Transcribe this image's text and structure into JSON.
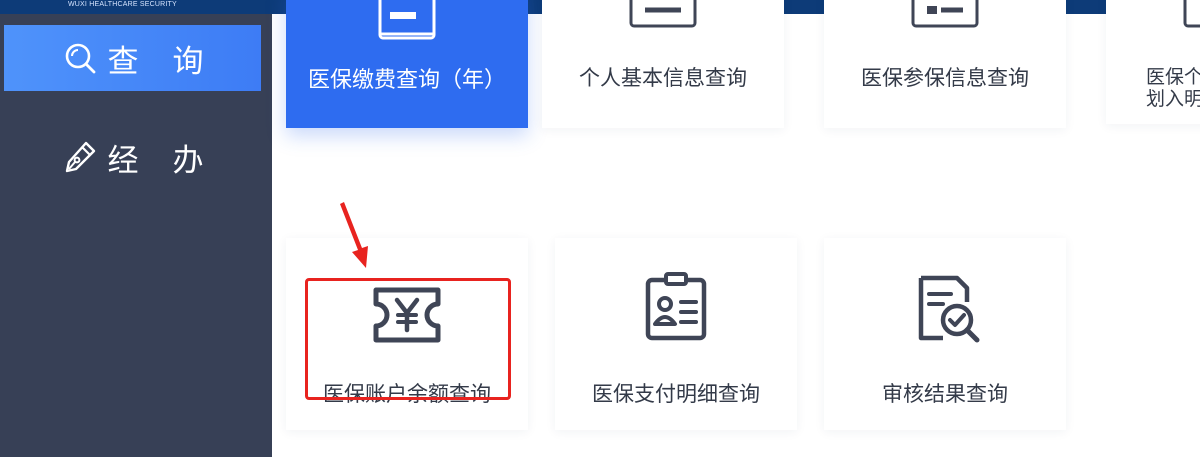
{
  "header": {
    "brand_subtitle": "WUXI HEALTHCARE SECURITY"
  },
  "sidebar": {
    "items": [
      {
        "label": "查询",
        "icon": "search-icon",
        "active": true
      },
      {
        "label": "经办",
        "icon": "pen-icon",
        "active": false
      }
    ]
  },
  "cards_top": [
    {
      "label": "医保缴费查询（年）",
      "selected": true,
      "icon": "document-card-icon"
    },
    {
      "label": "个人基本信息查询",
      "selected": false,
      "icon": "document-card-icon"
    },
    {
      "label": "医保参保信息查询",
      "selected": false,
      "icon": "document-card-icon"
    },
    {
      "label_line1": "医保个",
      "label_line2": "划入明",
      "selected": false,
      "icon": "document-card-icon"
    }
  ],
  "cards_bottom": [
    {
      "label": "医保账户余额查询",
      "icon": "yen-ticket-icon",
      "highlighted": true
    },
    {
      "label": "医保支付明细查询",
      "icon": "id-badge-icon",
      "highlighted": false
    },
    {
      "label": "审核结果查询",
      "icon": "document-check-icon",
      "highlighted": false
    }
  ],
  "colors": {
    "sidebar_bg": "#374056",
    "active_blue": "#3d7cf5",
    "selected_card_blue": "#2e6cf0",
    "annotation_red": "#e8231f",
    "icon_stroke": "#3f4556"
  }
}
